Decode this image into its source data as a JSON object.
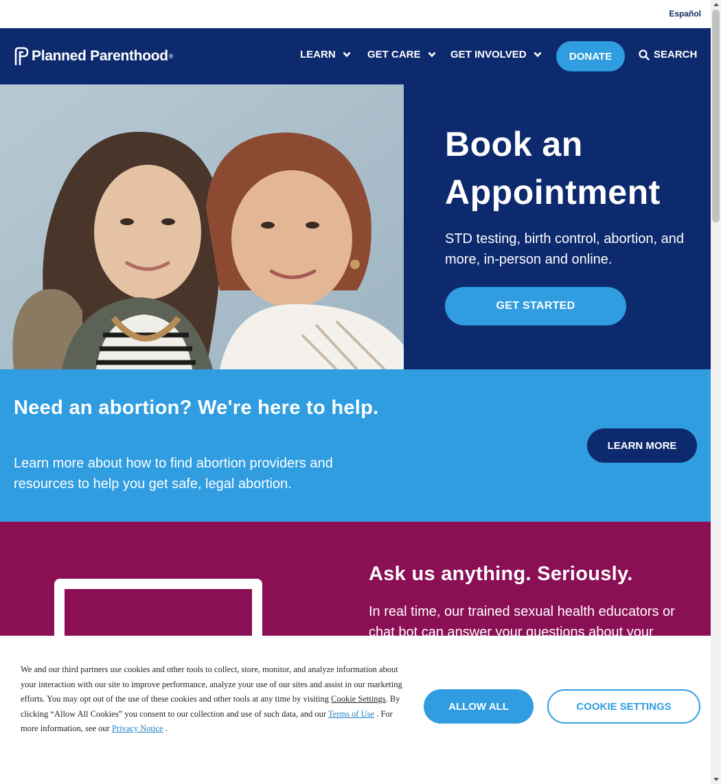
{
  "utility": {
    "language_link": "Español"
  },
  "nav": {
    "logo_text": "Planned Parenthood",
    "logo_mark": "®",
    "items": [
      {
        "label": "LEARN"
      },
      {
        "label": "GET CARE"
      },
      {
        "label": "GET INVOLVED"
      }
    ],
    "donate_label": "DONATE",
    "search_label": "SEARCH"
  },
  "hero": {
    "title_line1": "Book an",
    "title_line2": "Appointment",
    "subtitle": "STD testing, birth control, abortion, and more, in-person and online.",
    "cta_label": "GET STARTED",
    "photo_icon": "two-women-portrait-photo"
  },
  "abortion_band": {
    "heading": "Need an abortion? We're here to help.",
    "body": "Learn more about how to find abortion providers and resources to help you get safe, legal abortion.",
    "cta_label": "LEARN MORE"
  },
  "chat_section": {
    "heading": "Ask us anything. Seriously.",
    "body": "In real time, our trained sexual health educators or chat bot can answer your questions about your"
  },
  "cookie_banner": {
    "text_1": "We and our third partners use cookies and other tools to collect, store, monitor, and analyze information about your interaction with our site to improve performance, analyze your use of our sites and assist in our marketing efforts. You may opt out of the use of these cookies and other tools at any time by visiting ",
    "link_cookie_settings": "Cookie Settings",
    "text_2": ". By clicking “Allow All Cookies” you consent to our collection and use of such data, and our ",
    "link_terms": "Terms of Use",
    "text_3": " . For more information, see our ",
    "link_privacy": "Privacy Notice",
    "text_4": " .",
    "allow_label": "ALLOW ALL",
    "settings_label": "COOKIE SETTINGS"
  },
  "colors": {
    "navy": "#0d2a6e",
    "sky_blue": "#2f9de0",
    "magenta": "#8a0f55",
    "white": "#ffffff"
  }
}
